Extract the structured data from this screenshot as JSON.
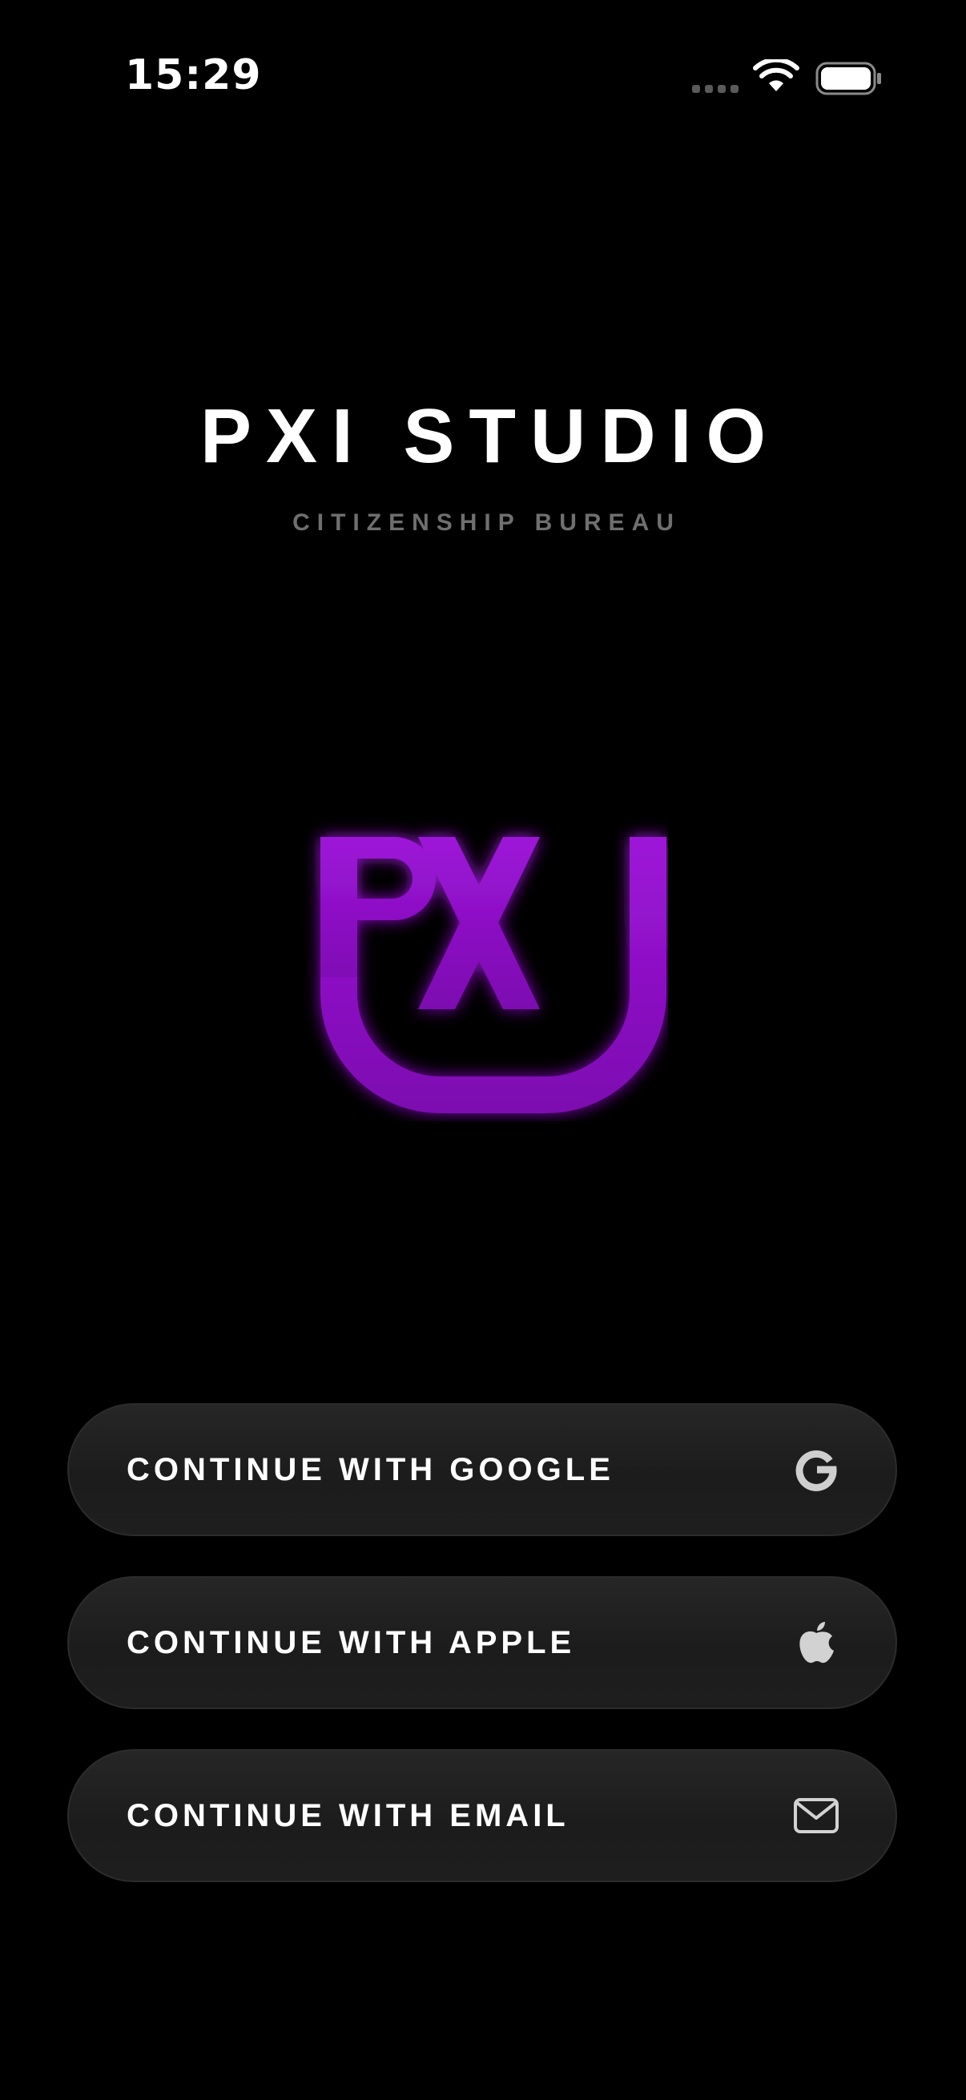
{
  "status_bar": {
    "time": "15:29"
  },
  "brand": {
    "title": "PXI STUDIO",
    "subtitle": "CITIZENSHIP BUREAU",
    "logo_text": "PXI",
    "logo_color": "#9b12d6"
  },
  "auth_buttons": [
    {
      "label": "CONTINUE WITH GOOGLE",
      "icon": "google-icon"
    },
    {
      "label": "CONTINUE WITH APPLE",
      "icon": "apple-icon"
    },
    {
      "label": "CONTINUE WITH EMAIL",
      "icon": "mail-icon"
    }
  ]
}
